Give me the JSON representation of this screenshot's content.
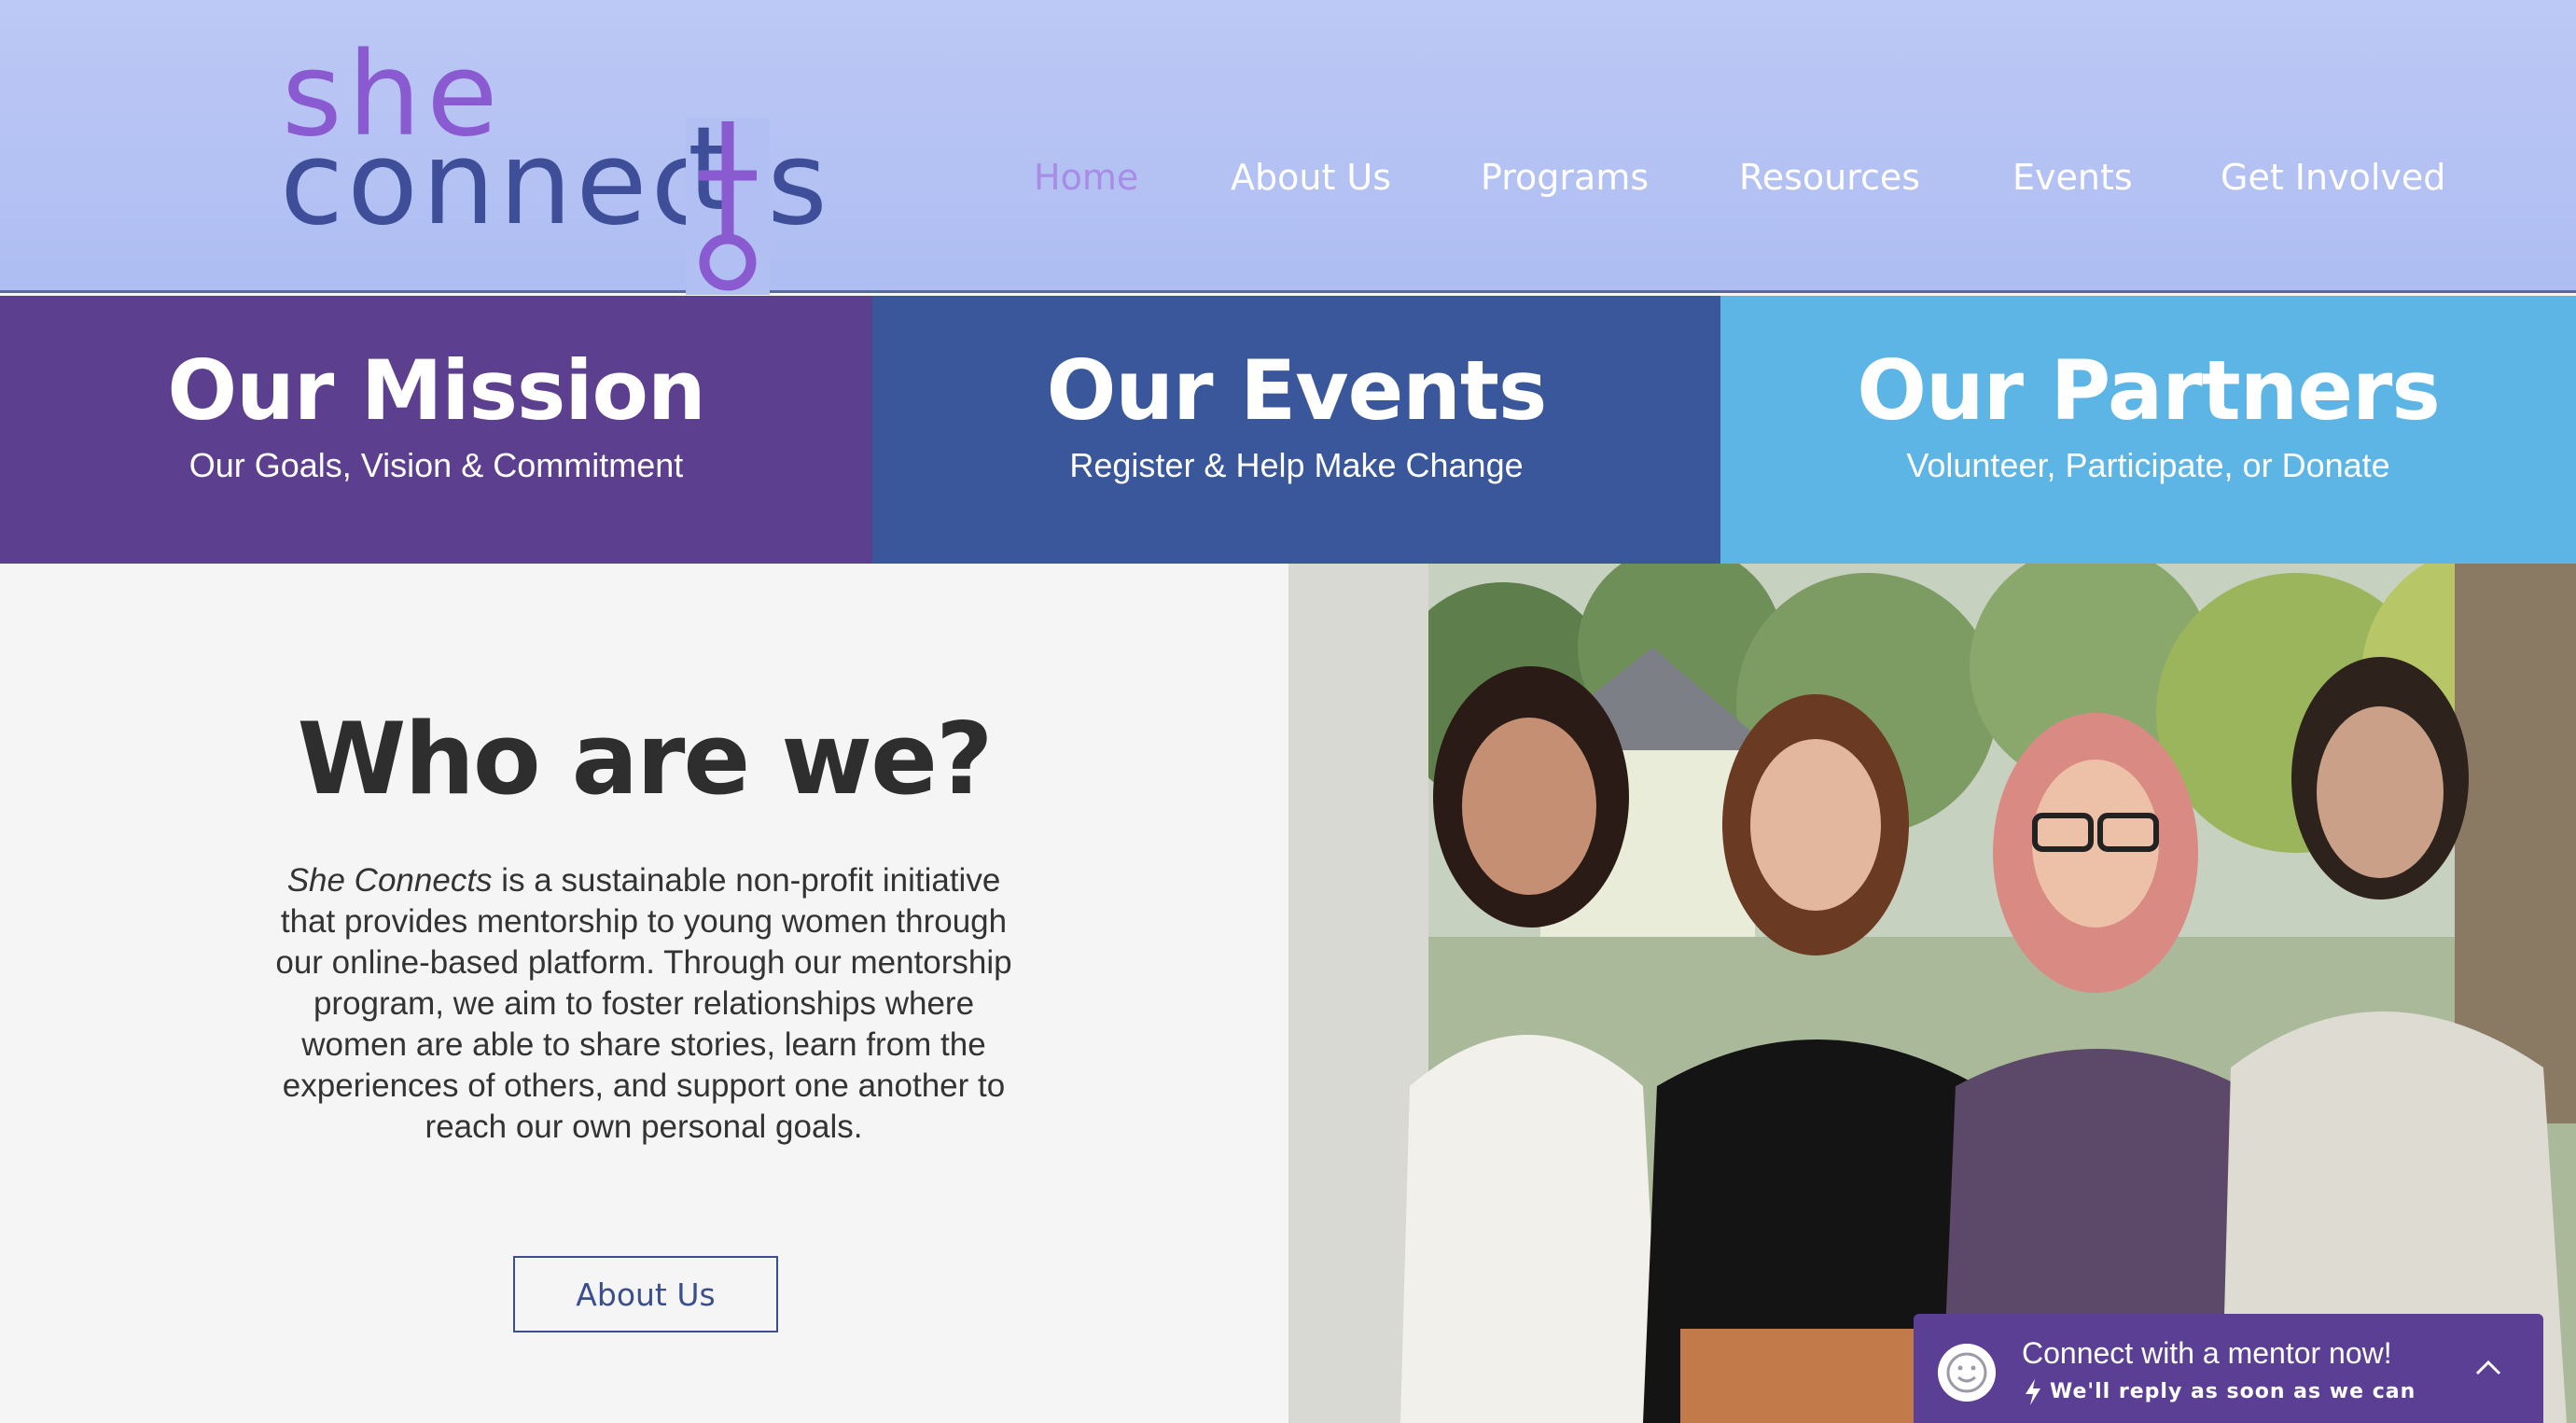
{
  "header": {
    "logo": {
      "line1": "she",
      "line2": "connects"
    },
    "nav": [
      {
        "label": "Home",
        "active": true
      },
      {
        "label": "About Us",
        "active": false
      },
      {
        "label": "Programs",
        "active": false
      },
      {
        "label": "Resources",
        "active": false
      },
      {
        "label": "Events",
        "active": false
      },
      {
        "label": "Get Involved",
        "active": false
      }
    ]
  },
  "tiles": [
    {
      "title": "Our Mission",
      "subtitle": "Our Goals, Vision & Commitment",
      "color": "#5d3f8f"
    },
    {
      "title": "Our Events",
      "subtitle": "Register & Help Make Change",
      "color": "#39579a"
    },
    {
      "title": "Our Partners",
      "subtitle": "Volunteer, Participate, or Donate",
      "color": "#5db5e5"
    }
  ],
  "about": {
    "title": "Who are we?",
    "brand": "She Connects",
    "body": " is a sustainable non-profit initiative that provides mentorship to young women through our online-based platform. Through our mentorship program, we aim to foster relationships where women are able to share stories, learn from the experiences of others, and support one another to reach our own personal goals.",
    "button_label": "About Us"
  },
  "chat": {
    "title": "Connect with a mentor now!",
    "subtitle": "We'll reply as soon as we can",
    "icons": [
      "smiley-icon",
      "lightning-icon",
      "chevron-up-icon"
    ]
  },
  "colors": {
    "header_bg": "#b6c4f4",
    "nav_active": "#a88ce6",
    "logo_purple": "#8a5bd0",
    "logo_navy": "#3f4e99",
    "chat_bg": "#5a3f94"
  }
}
